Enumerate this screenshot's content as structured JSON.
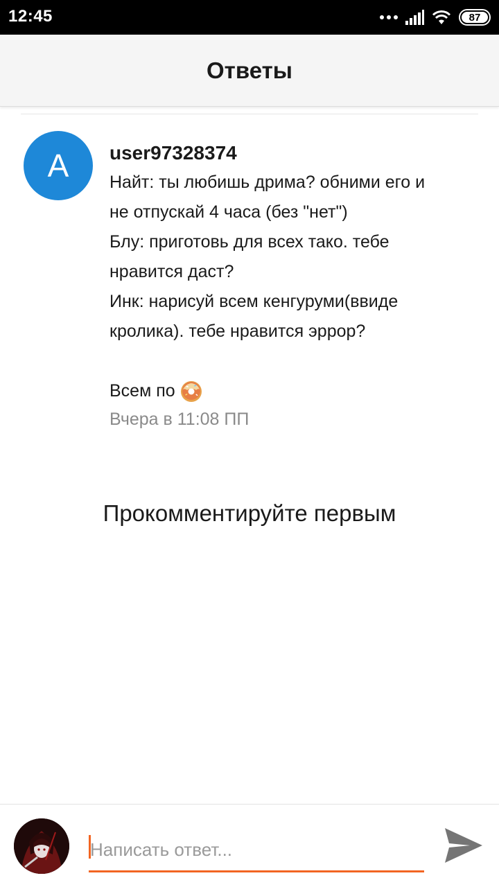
{
  "status_bar": {
    "time": "12:45",
    "battery": "87",
    "icons": [
      "signal-dots-icon",
      "cellular-signal-icon",
      "wifi-icon",
      "battery-icon"
    ]
  },
  "header": {
    "title": "Ответы"
  },
  "post": {
    "avatar_letter": "A",
    "avatar_color": "#1e88d8",
    "username": "user97328374",
    "lines": [
      "Найт: ты любишь дрима? обними его и",
      "не отпускай 4 часа (без \"нет\")",
      "Блу: приготовь для всех тако. тебе",
      "нравится даст?",
      "Инк: нарисуй всем кенгуруми(ввиде",
      "кролика). тебе нравится эррор?"
    ],
    "closing_text": "Всем по",
    "closing_icon": "donut-icon",
    "timestamp": "Вчера в 11:08 ПП"
  },
  "empty_state": {
    "text": "Прокомментируйте первым"
  },
  "reply_bar": {
    "placeholder": "Написать ответ...",
    "accent_color": "#f26522",
    "send_icon": "send-icon"
  }
}
